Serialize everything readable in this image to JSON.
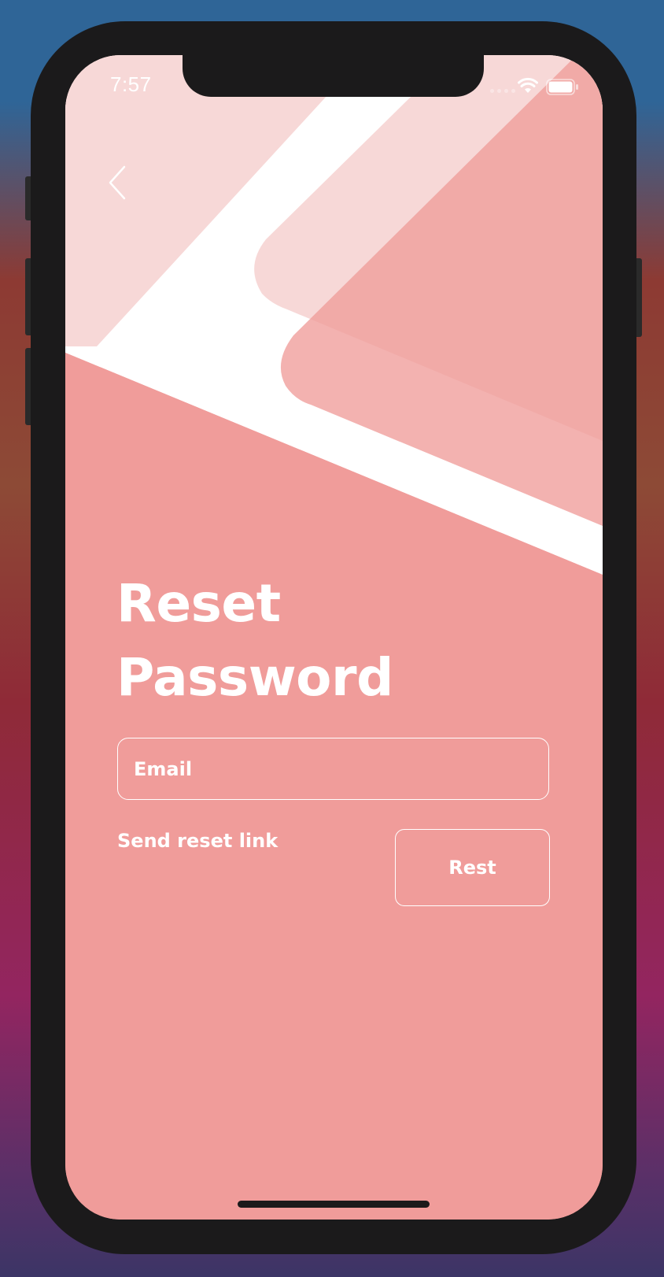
{
  "status_bar": {
    "time": "7:57",
    "icons": [
      "signal-icon",
      "wifi-icon",
      "battery-icon"
    ]
  },
  "nav": {
    "back_icon": "chevron-left-icon"
  },
  "page": {
    "title_line1": "Reset",
    "title_line2": "Password"
  },
  "form": {
    "email_placeholder": "Email",
    "email_value": "",
    "send_link_label": "Send reset link",
    "submit_label": "Rest"
  },
  "colors": {
    "background": "#f09c9a",
    "light_shape": "#f7d8d7",
    "accent_shape": "#f2adab",
    "text": "#ffffff",
    "device_frame": "#1b1a1b"
  }
}
